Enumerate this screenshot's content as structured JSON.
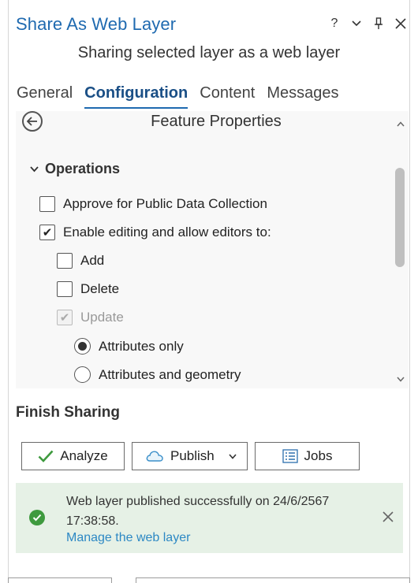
{
  "window": {
    "title": "Share As Web Layer",
    "subtitle": "Sharing selected layer as a web layer",
    "tools": {
      "help": "?",
      "options": "⌄",
      "pin": "⊥",
      "close": "✕"
    }
  },
  "tabs": [
    {
      "label": "General",
      "active": false
    },
    {
      "label": "Configuration",
      "active": true
    },
    {
      "label": "Content",
      "active": false
    },
    {
      "label": "Messages",
      "active": false
    }
  ],
  "feature_properties": {
    "title": "Feature Properties",
    "operations": {
      "label": "Operations",
      "approve_public": {
        "label": "Approve for Public Data Collection",
        "checked": false
      },
      "enable_editing": {
        "label": "Enable editing and allow editors to:",
        "checked": true
      },
      "add": {
        "label": "Add",
        "checked": false
      },
      "delete": {
        "label": "Delete",
        "checked": false
      },
      "update": {
        "label": "Update",
        "checked": true,
        "disabled": true
      },
      "update_options": {
        "attributes_only": {
          "label": "Attributes only",
          "selected": true
        },
        "attributes_geometry": {
          "label": "Attributes and geometry",
          "selected": false
        }
      }
    }
  },
  "finish": {
    "title": "Finish Sharing",
    "analyze_label": "Analyze",
    "publish_label": "Publish",
    "jobs_label": "Jobs"
  },
  "notification": {
    "message": "Web layer published successfully on 24/6/2567 17:38:58.",
    "link": "Manage the web layer",
    "status_color": "#3e9a3e",
    "background": "#e6f1e6"
  },
  "colors": {
    "accent": "#1f6ab0",
    "link": "#2c88c4"
  }
}
